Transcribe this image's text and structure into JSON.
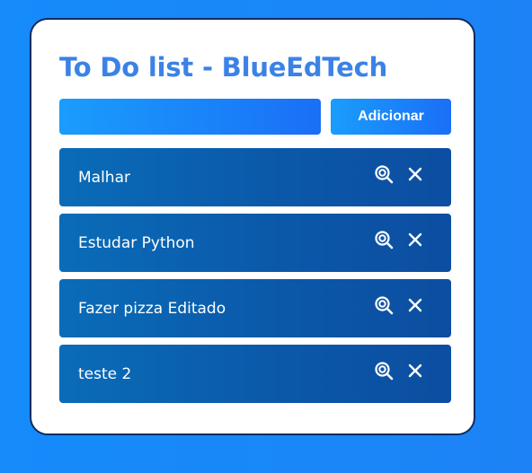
{
  "app": {
    "title": "To Do list - BlueEdTech"
  },
  "form": {
    "input_value": "",
    "input_placeholder": "",
    "add_button_label": "Adicionar"
  },
  "todos": [
    {
      "text": "Malhar",
      "edit_icon": "search-edit-icon",
      "delete_icon": "close-icon"
    },
    {
      "text": "Estudar Python",
      "edit_icon": "search-edit-icon",
      "delete_icon": "close-icon"
    },
    {
      "text": "Fazer pizza Editado",
      "edit_icon": "search-edit-icon",
      "delete_icon": "close-icon"
    },
    {
      "text": "teste 2",
      "edit_icon": "search-edit-icon",
      "delete_icon": "close-icon"
    }
  ],
  "colors": {
    "background": "#1a86f7",
    "title": "#3b82e6",
    "card_border": "#0d2c5c",
    "item_bg": "#0b57a8",
    "button_bg": "#1a85f8"
  }
}
